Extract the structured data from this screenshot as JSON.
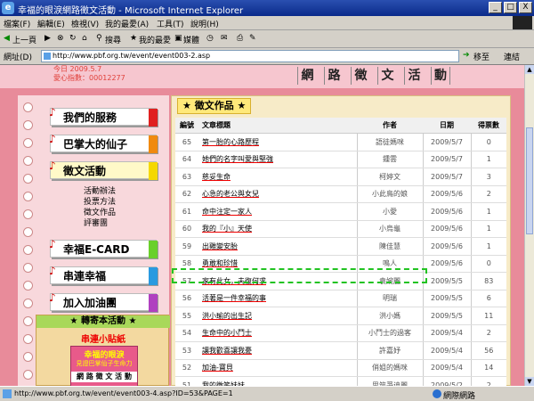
{
  "window": {
    "title": "幸福的眼淚網路徵文活動 - Microsoft Internet Explorer",
    "min": "_",
    "max": "□",
    "close": "X"
  },
  "menu": [
    "檔案(F)",
    "編輯(E)",
    "檢視(V)",
    "我的最愛(A)",
    "工具(T)",
    "說明(H)"
  ],
  "toolbar": {
    "back": "上一頁",
    "search": "搜尋",
    "favorites": "我的最愛",
    "media": "媒體"
  },
  "address": {
    "label": "網址(D)",
    "url": "http://www.pbf.org.tw/event/event003-2.asp",
    "go": "移至",
    "links": "連結"
  },
  "header": {
    "info_date": "今日 2009.5.7",
    "info_count": "愛心指數：00012277",
    "banner": [
      "網",
      "路",
      "徵",
      "文",
      "活",
      "動"
    ]
  },
  "sidebar": {
    "nav": [
      {
        "label": "我們的服務",
        "color": "#e02020"
      },
      {
        "label": "巴掌大的仙子",
        "color": "#f08a10"
      },
      {
        "label": "徵文活動",
        "color": "#f5d800"
      },
      {
        "label": "幸福E-CARD",
        "color": "#6ad02a"
      },
      {
        "label": "串連幸福",
        "color": "#2a9ae0"
      },
      {
        "label": "加入加油團",
        "color": "#b040c0"
      }
    ],
    "subitems": [
      "活動辦法",
      "投票方法",
      "徵文作品",
      "評審團"
    ],
    "recommend_title": "★ 轉寄本活動 ★",
    "recommend_link": "串連小貼紙",
    "card_title": "幸福的眼淚",
    "card_sub": "見證巴掌仙子生命力",
    "card_footer": "網 路 徵 文 活 動"
  },
  "works": {
    "title": "★ 徵文作品 ★",
    "columns": [
      "編號",
      "文章標題",
      "作者",
      "日期",
      "得票數"
    ],
    "rows": [
      [
        "65",
        "第一胎的心路歷程",
        "語徒媽咪",
        "2009/5/7",
        "0"
      ],
      [
        "64",
        "她們的名字叫愛與堅強",
        "鍾雲",
        "2009/5/7",
        "1"
      ],
      [
        "63",
        "慈妥生命",
        "柯婷文",
        "2009/5/7",
        "3"
      ],
      [
        "62",
        "心急的老公與女兒",
        "小此鳥的娘",
        "2009/5/6",
        "2"
      ],
      [
        "61",
        "命中注定一家人",
        "小愛",
        "2009/5/6",
        "1"
      ],
      [
        "60",
        "我的『小』天使",
        "小烏龜",
        "2009/5/6",
        "1"
      ],
      [
        "59",
        "出雞變安胎",
        "陳佳慧",
        "2009/5/6",
        "1"
      ],
      [
        "58",
        "勇敢和珍惜",
        "鳴人",
        "2009/5/6",
        "0"
      ],
      [
        "57",
        "家有此女，夫復何求",
        "袁婉麗",
        "2009/5/5",
        "83"
      ],
      [
        "56",
        "活著是一件幸福的事",
        "明瑞",
        "2009/5/5",
        "6"
      ],
      [
        "55",
        "洪小瑜的出生記",
        "洪小媽",
        "2009/5/5",
        "11"
      ],
      [
        "54",
        "生命中的小鬥士",
        "小鬥士的過客",
        "2009/5/4",
        "2"
      ],
      [
        "53",
        "讓我歡喜讓我憂",
        "許嘉妤",
        "2009/5/4",
        "56"
      ],
      [
        "52",
        "加油-寶貝",
        "俏姐的媽咪",
        "2009/5/4",
        "14"
      ],
      [
        "51",
        "我的微笑妹妹",
        "思筑爭迪麗",
        "2009/5/2",
        "2"
      ]
    ]
  },
  "status": {
    "text": "http://www.pbf.org.tw/event/event003-4.asp?ID=53&PAGE=1",
    "zone": "網際網路"
  }
}
